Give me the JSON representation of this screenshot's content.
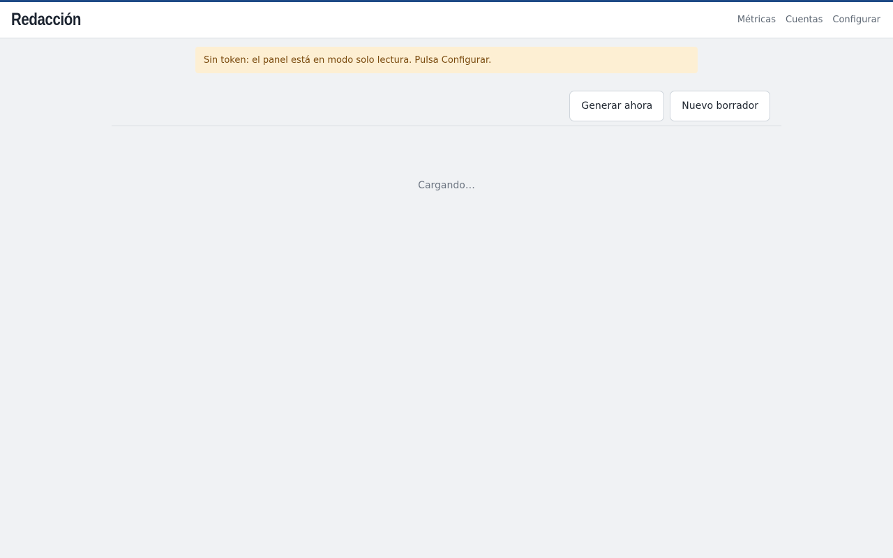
{
  "header": {
    "brand": "Redacción",
    "nav": [
      {
        "label": "Métricas"
      },
      {
        "label": "Cuentas"
      },
      {
        "label": "Configurar"
      }
    ]
  },
  "alert": {
    "message": "Sin token: el panel está en modo solo lectura. Pulsa Configurar."
  },
  "toolbar": {
    "generate_label": "Generar ahora",
    "new_draft_label": "Nuevo borrador"
  },
  "main": {
    "loading_text": "Cargando…"
  },
  "colors": {
    "accent": "#1e4a86",
    "background": "#f0f2f4",
    "alert_bg": "#fdefd3",
    "alert_text": "#7a4a0e"
  }
}
